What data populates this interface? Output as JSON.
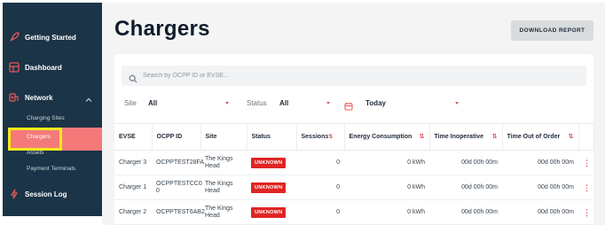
{
  "sidebar": {
    "items": [
      {
        "label": "Getting Started",
        "icon": "rocket-icon"
      },
      {
        "label": "Dashboard",
        "icon": "dashboard-icon"
      },
      {
        "label": "Network",
        "icon": "network-icon"
      },
      {
        "label": "Session Log",
        "icon": "bolt-icon"
      }
    ],
    "network_sub": [
      "Charging Sites",
      "Chargers",
      "Assets",
      "Payment Terminals"
    ]
  },
  "page": {
    "title": "Chargers",
    "download_label": "DOWNLOAD REPORT"
  },
  "search": {
    "placeholder": "Search by OCPP ID or EVSE..."
  },
  "filters": {
    "site_label": "Site",
    "site_value": "All",
    "status_label": "Status",
    "status_value": "All",
    "date_value": "Today"
  },
  "table": {
    "headers": {
      "evse": "EVSE",
      "ocpp": "OCPP ID",
      "site": "Site",
      "status": "Status",
      "sessions": "Sessions",
      "energy": "Energy Consumption",
      "inoperative": "Time Inoperative",
      "out_of_order": "Time Out of Order"
    },
    "rows": [
      {
        "evse": "Charger 3",
        "ocpp": "OCPPTEST28FA",
        "site": "The Kings Head",
        "status": "UNKNOWN",
        "sessions": "0",
        "energy": "0 kWh",
        "inoperative": "00d 00h 00m",
        "out_of_order": "00d 00h 00m"
      },
      {
        "evse": "Charger 1",
        "ocpp": "OCPPTESTCC0 0",
        "site": "The Kings Head",
        "status": "UNKNOWN",
        "sessions": "0",
        "energy": "0 kWh",
        "inoperative": "00d 00h 00m",
        "out_of_order": "00d 00h 00m"
      },
      {
        "evse": "Charger 2",
        "ocpp": "OCPPTEST6AB2",
        "site": "The Kings Head",
        "status": "UNKNOWN",
        "sessions": "0",
        "energy": "0 kWh",
        "inoperative": "00d 00h 00m",
        "out_of_order": "00d 00h 00m"
      }
    ]
  },
  "colors": {
    "sidebar_bg": "#1b3447",
    "active_bg": "#f47a7a",
    "highlight": "#f6ea19",
    "badge_red": "#e02424",
    "accent": "#e05a5a"
  }
}
